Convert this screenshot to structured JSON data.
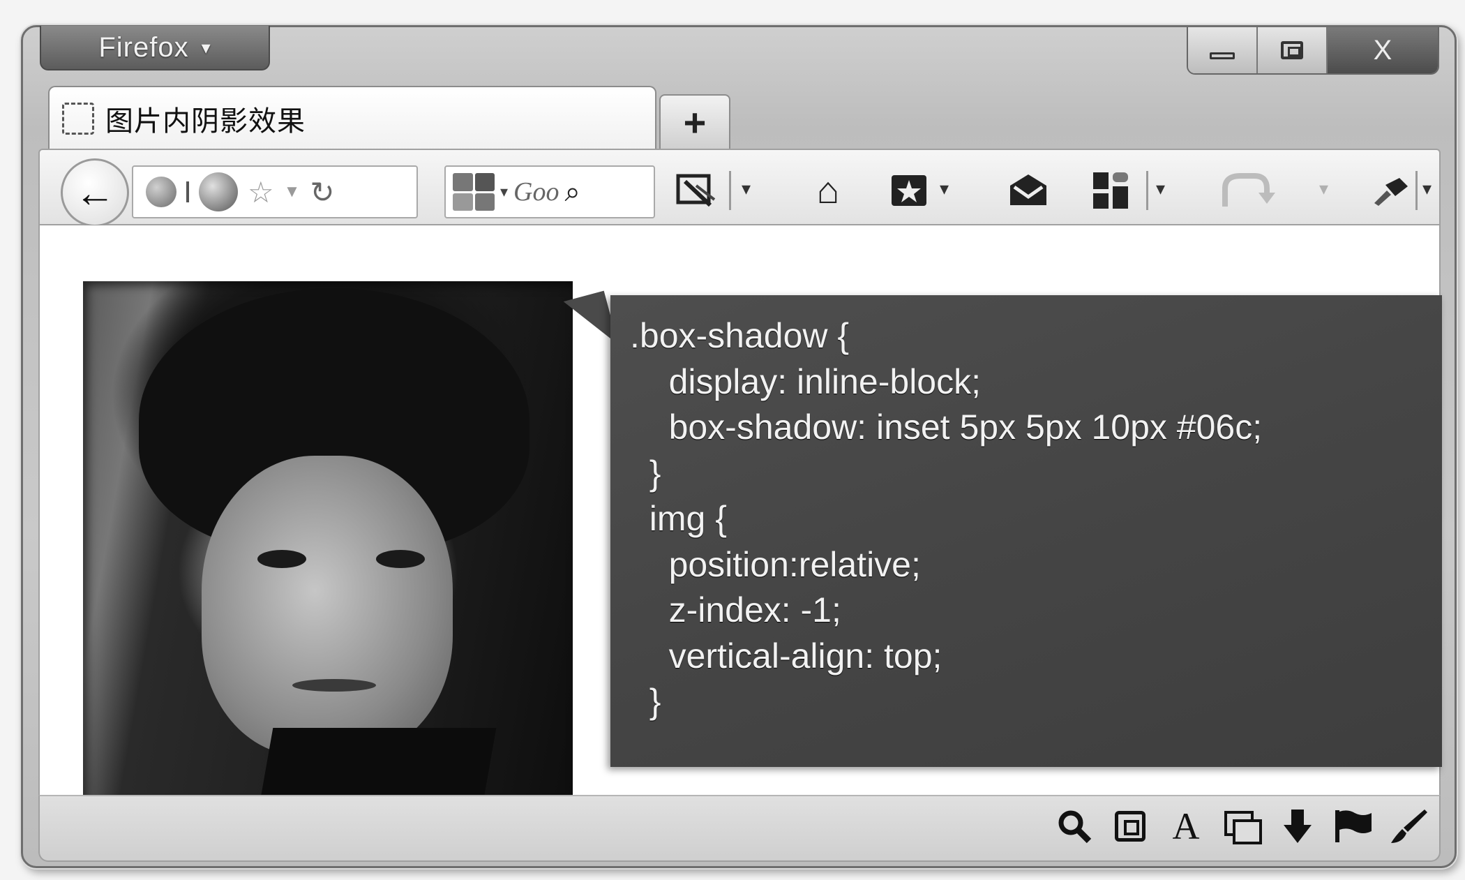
{
  "app_button": {
    "label": "Firefox",
    "caret": "▾"
  },
  "window_controls": {
    "minimize_icon": "minimize-icon",
    "maximize_icon": "maximize-icon",
    "close_label": "X"
  },
  "tabs": [
    {
      "title": "图片内阴影效果",
      "favicon": "blank-page-icon",
      "active": true
    }
  ],
  "new_tab_label": "+",
  "navbar": {
    "back_icon": "←",
    "reload_icon": "↻",
    "search_text": "Goo",
    "search_icon": "⌕",
    "home_icon": "⌂",
    "dropdown_caret": "▾"
  },
  "code_block": {
    "lines": [
      ".box-shadow {",
      "    display: inline-block;",
      "    box-shadow: inset 5px 5px 10px #06c;",
      "  }",
      "  img {",
      "    position:relative;",
      "    z-index: -1;",
      "    vertical-align: top;",
      "  }"
    ]
  },
  "image": {
    "alt_name": "portrait-photo"
  },
  "status_bar": {
    "icons": [
      "magnifier-icon",
      "edit-box-icon",
      "font-icon",
      "windows-icon",
      "download-icon",
      "flag-icon",
      "brush-icon"
    ],
    "font_glyph": "A"
  },
  "colors": {
    "code_bg": "#484848",
    "code_text": "#f2f2f2",
    "chrome": "#c8c8c8"
  }
}
